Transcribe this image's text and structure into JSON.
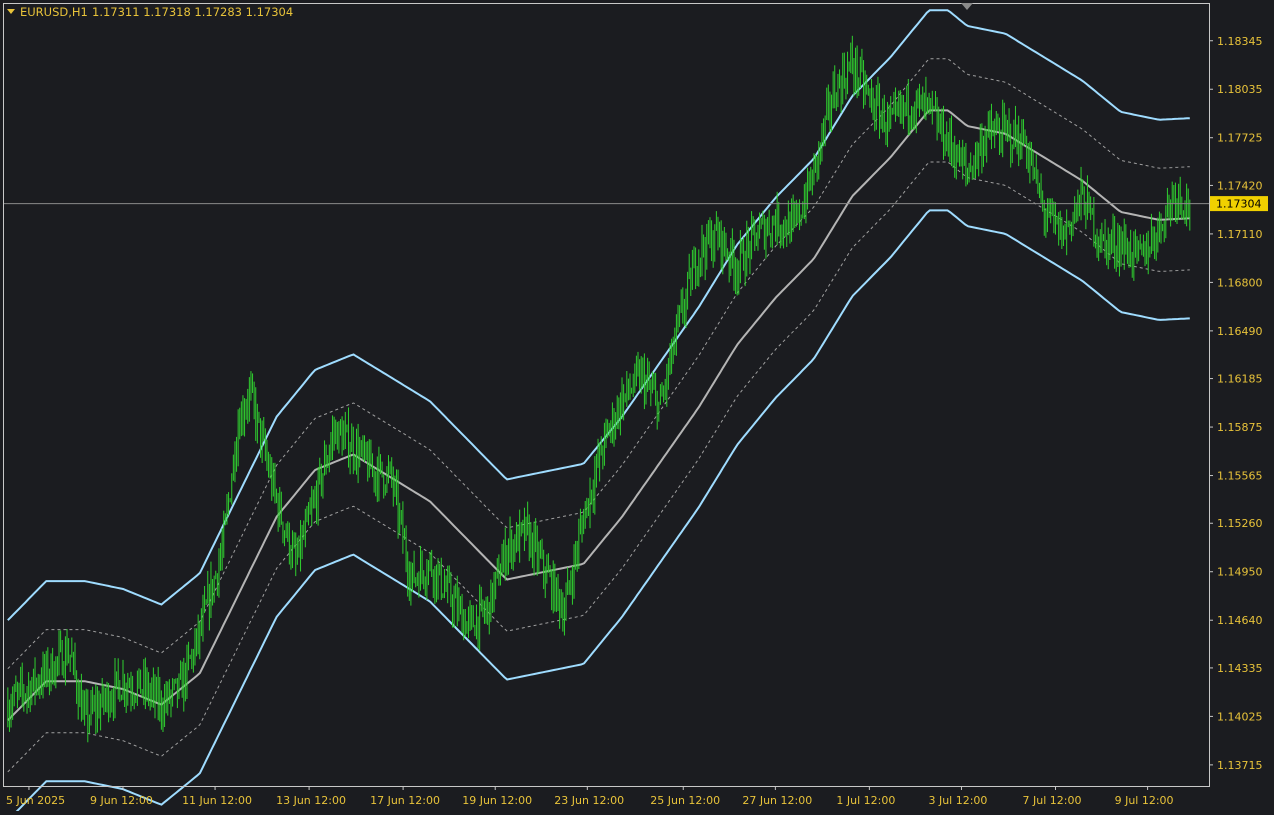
{
  "header": {
    "symbol": "EURUSD,H1",
    "ohlc": "1.17311 1.17318 1.17283 1.17304"
  },
  "current_price": "1.17304",
  "colors": {
    "background": "#1b1c20",
    "axis_text": "#e8c33a",
    "price_bars": "#2fcf2f",
    "middle_line": "#b4b4b4",
    "outer_bands": "#9fdcff",
    "inner_bands": "#a0a0a0",
    "price_tag_bg": "#f0d000"
  },
  "chart_data": {
    "type": "line",
    "symbol": "EURUSD",
    "timeframe": "H1",
    "y_ticks": [
      "1.18345",
      "1.18035",
      "1.17725",
      "1.17420",
      "1.17110",
      "1.16800",
      "1.16490",
      "1.16185",
      "1.15875",
      "1.15565",
      "1.15260",
      "1.14950",
      "1.14640",
      "1.14335",
      "1.14025",
      "1.13715"
    ],
    "x_ticks": [
      "5 Jun 2025",
      "9 Jun 12:00",
      "11 Jun 12:00",
      "13 Jun 12:00",
      "17 Jun 12:00",
      "19 Jun 12:00",
      "23 Jun 12:00",
      "25 Jun 12:00",
      "27 Jun 12:00",
      "1 Jul 12:00",
      "3 Jul 12:00",
      "7 Jul 12:00",
      "9 Jul 12:00"
    ],
    "ylim": [
      1.1358,
      1.1858
    ],
    "current_price": 1.17304,
    "price_path": [
      {
        "x": 0.0,
        "y": 1.141
      },
      {
        "x": 1.0,
        "y": 1.143
      },
      {
        "x": 1.6,
        "y": 1.1445
      },
      {
        "x": 2.0,
        "y": 1.14
      },
      {
        "x": 2.6,
        "y": 1.1415
      },
      {
        "x": 3.0,
        "y": 1.1425
      },
      {
        "x": 3.6,
        "y": 1.142
      },
      {
        "x": 4.0,
        "y": 1.141
      },
      {
        "x": 4.5,
        "y": 1.142
      },
      {
        "x": 5.0,
        "y": 1.1455
      },
      {
        "x": 5.6,
        "y": 1.151
      },
      {
        "x": 6.0,
        "y": 1.159
      },
      {
        "x": 6.3,
        "y": 1.161
      },
      {
        "x": 6.6,
        "y": 1.158
      },
      {
        "x": 7.0,
        "y": 1.154
      },
      {
        "x": 7.5,
        "y": 1.15
      },
      {
        "x": 8.0,
        "y": 1.154
      },
      {
        "x": 8.5,
        "y": 1.1585
      },
      {
        "x": 9.0,
        "y": 1.1575
      },
      {
        "x": 9.5,
        "y": 1.156
      },
      {
        "x": 10.0,
        "y": 1.1555
      },
      {
        "x": 10.5,
        "y": 1.149
      },
      {
        "x": 11.0,
        "y": 1.15
      },
      {
        "x": 11.5,
        "y": 1.148
      },
      {
        "x": 12.0,
        "y": 1.146
      },
      {
        "x": 12.5,
        "y": 1.147
      },
      {
        "x": 13.0,
        "y": 1.151
      },
      {
        "x": 13.5,
        "y": 1.152
      },
      {
        "x": 14.0,
        "y": 1.1495
      },
      {
        "x": 14.5,
        "y": 1.147
      },
      {
        "x": 15.0,
        "y": 1.153
      },
      {
        "x": 15.5,
        "y": 1.1575
      },
      {
        "x": 16.0,
        "y": 1.1605
      },
      {
        "x": 16.5,
        "y": 1.162
      },
      {
        "x": 17.0,
        "y": 1.16
      },
      {
        "x": 17.5,
        "y": 1.1655
      },
      {
        "x": 18.0,
        "y": 1.17
      },
      {
        "x": 18.5,
        "y": 1.171
      },
      {
        "x": 19.0,
        "y": 1.169
      },
      {
        "x": 19.5,
        "y": 1.171
      },
      {
        "x": 20.0,
        "y": 1.172
      },
      {
        "x": 20.5,
        "y": 1.1715
      },
      {
        "x": 21.0,
        "y": 1.175
      },
      {
        "x": 21.5,
        "y": 1.18
      },
      {
        "x": 22.0,
        "y": 1.182
      },
      {
        "x": 22.5,
        "y": 1.1795
      },
      {
        "x": 23.0,
        "y": 1.178
      },
      {
        "x": 23.5,
        "y": 1.1795
      },
      {
        "x": 24.0,
        "y": 1.179
      },
      {
        "x": 24.5,
        "y": 1.177
      },
      {
        "x": 25.0,
        "y": 1.175
      },
      {
        "x": 25.5,
        "y": 1.1775
      },
      {
        "x": 26.0,
        "y": 1.1775
      },
      {
        "x": 26.5,
        "y": 1.177
      },
      {
        "x": 27.0,
        "y": 1.1725
      },
      {
        "x": 27.5,
        "y": 1.171
      },
      {
        "x": 28.0,
        "y": 1.1735
      },
      {
        "x": 28.5,
        "y": 1.1705
      },
      {
        "x": 29.0,
        "y": 1.1705
      },
      {
        "x": 29.5,
        "y": 1.1695
      },
      {
        "x": 30.0,
        "y": 1.1715
      },
      {
        "x": 30.4,
        "y": 1.1738
      },
      {
        "x": 30.8,
        "y": 1.173
      }
    ],
    "middle_line": [
      {
        "x": 0.0,
        "y": 1.14
      },
      {
        "x": 1.0,
        "y": 1.1425
      },
      {
        "x": 2.0,
        "y": 1.1425
      },
      {
        "x": 3.0,
        "y": 1.142
      },
      {
        "x": 4.0,
        "y": 1.141
      },
      {
        "x": 5.0,
        "y": 1.143
      },
      {
        "x": 6.0,
        "y": 1.148
      },
      {
        "x": 7.0,
        "y": 1.153
      },
      {
        "x": 8.0,
        "y": 1.156
      },
      {
        "x": 9.0,
        "y": 1.157
      },
      {
        "x": 10.0,
        "y": 1.1555
      },
      {
        "x": 11.0,
        "y": 1.154
      },
      {
        "x": 12.0,
        "y": 1.1515
      },
      {
        "x": 13.0,
        "y": 1.149
      },
      {
        "x": 14.0,
        "y": 1.1495
      },
      {
        "x": 15.0,
        "y": 1.15
      },
      {
        "x": 16.0,
        "y": 1.153
      },
      {
        "x": 17.0,
        "y": 1.1565
      },
      {
        "x": 18.0,
        "y": 1.16
      },
      {
        "x": 19.0,
        "y": 1.164
      },
      {
        "x": 20.0,
        "y": 1.167
      },
      {
        "x": 21.0,
        "y": 1.1695
      },
      {
        "x": 22.0,
        "y": 1.1735
      },
      {
        "x": 23.0,
        "y": 1.176
      },
      {
        "x": 24.0,
        "y": 1.179
      },
      {
        "x": 24.5,
        "y": 1.179
      },
      {
        "x": 25.0,
        "y": 1.178
      },
      {
        "x": 26.0,
        "y": 1.1775
      },
      {
        "x": 27.0,
        "y": 1.176
      },
      {
        "x": 28.0,
        "y": 1.1745
      },
      {
        "x": 29.0,
        "y": 1.1725
      },
      {
        "x": 30.0,
        "y": 1.172
      },
      {
        "x": 30.8,
        "y": 1.1721
      }
    ],
    "band_offsets": {
      "inner": 0.0033,
      "outer": 0.0064
    }
  }
}
